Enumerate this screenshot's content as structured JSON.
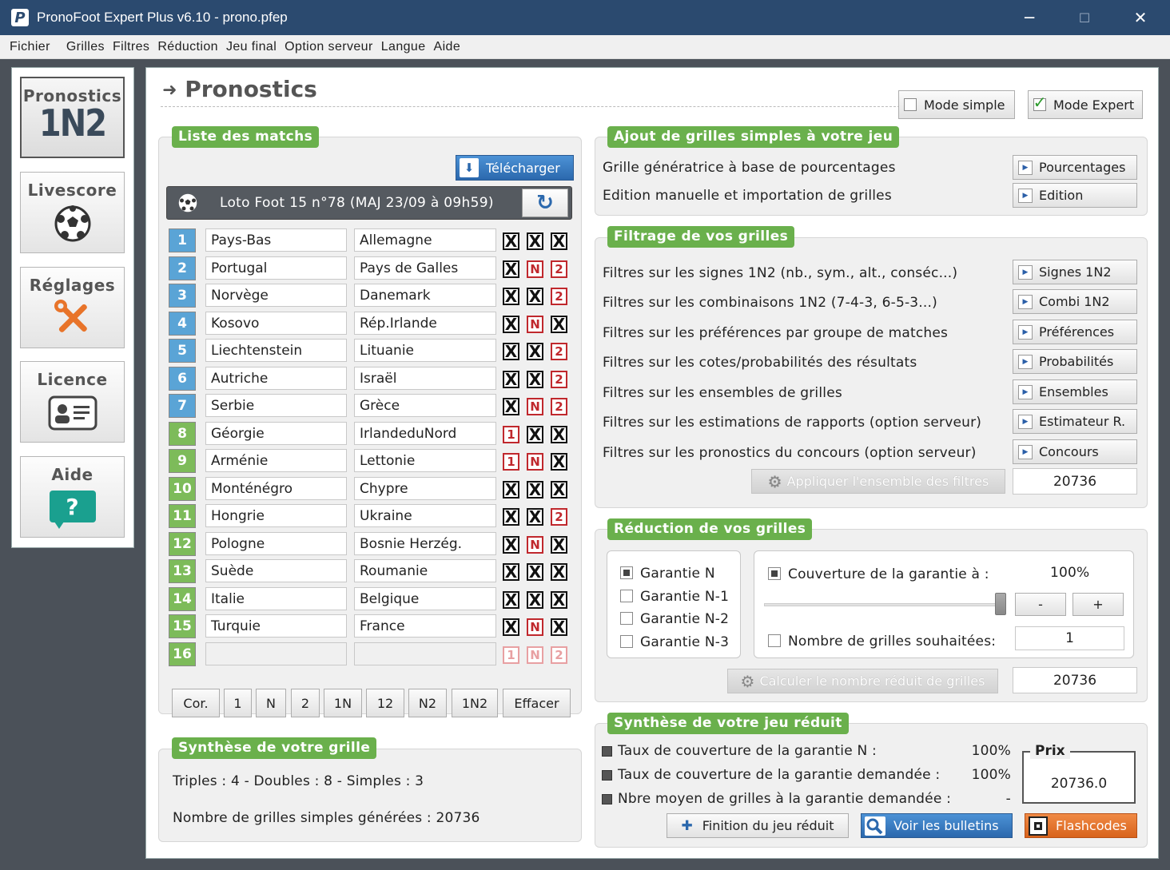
{
  "window": {
    "title": "PronoFoot Expert Plus v6.10 - prono.pfep",
    "app_icon": "P",
    "minimize": "─",
    "maximize": "☐",
    "close": "✕"
  },
  "menu": [
    "Fichier",
    "Grilles",
    "Filtres",
    "Réduction",
    "Jeu final",
    "Option serveur",
    "Langue",
    "Aide"
  ],
  "nav": [
    {
      "label": "Pronostics",
      "sub": "1N2",
      "icon": "1n2-icon"
    },
    {
      "label": "Livescore",
      "icon": "soccer-ball-icon"
    },
    {
      "label": "Réglages",
      "icon": "tools-icon"
    },
    {
      "label": "Licence",
      "icon": "id-card-icon"
    },
    {
      "label": "Aide",
      "icon": "help-bubble-icon",
      "glyph": "?"
    }
  ],
  "page": {
    "arrow": "➜",
    "title": "Pronostics",
    "mode_simple": "Mode simple",
    "mode_expert": "Mode Expert",
    "check": "✓"
  },
  "matches": {
    "section": "Liste des matchs",
    "download": "Télécharger",
    "download_icon": "⬇",
    "refresh": "↻",
    "header": "Loto Foot 15 n°78 (MAJ 23/09 à 09h59)",
    "rows": [
      {
        "n": "1",
        "home": "Pays-Bas",
        "away": "Allemagne",
        "s": [
          "X",
          "X",
          "X"
        ]
      },
      {
        "n": "2",
        "home": "Portugal",
        "away": "Pays de Galles",
        "s": [
          "X",
          "N",
          "2"
        ]
      },
      {
        "n": "3",
        "home": "Norvège",
        "away": "Danemark",
        "s": [
          "X",
          "X",
          "2"
        ]
      },
      {
        "n": "4",
        "home": "Kosovo",
        "away": "Rép.Irlande",
        "s": [
          "X",
          "N",
          "X"
        ]
      },
      {
        "n": "5",
        "home": "Liechtenstein",
        "away": "Lituanie",
        "s": [
          "X",
          "X",
          "2"
        ]
      },
      {
        "n": "6",
        "home": "Autriche",
        "away": "Israël",
        "s": [
          "X",
          "X",
          "2"
        ]
      },
      {
        "n": "7",
        "home": "Serbie",
        "away": "Grèce",
        "s": [
          "X",
          "N",
          "2"
        ]
      },
      {
        "n": "8",
        "home": "Géorgie",
        "away": "IrlandeduNord",
        "s": [
          "1",
          "X",
          "X"
        ]
      },
      {
        "n": "9",
        "home": "Arménie",
        "away": "Lettonie",
        "s": [
          "1",
          "N",
          "X"
        ]
      },
      {
        "n": "10",
        "home": "Monténégro",
        "away": "Chypre",
        "s": [
          "X",
          "X",
          "X"
        ]
      },
      {
        "n": "11",
        "home": "Hongrie",
        "away": "Ukraine",
        "s": [
          "X",
          "X",
          "2"
        ]
      },
      {
        "n": "12",
        "home": "Pologne",
        "away": "Bosnie Herzég.",
        "s": [
          "X",
          "N",
          "X"
        ]
      },
      {
        "n": "13",
        "home": "Suède",
        "away": "Roumanie",
        "s": [
          "X",
          "X",
          "X"
        ]
      },
      {
        "n": "14",
        "home": "Italie",
        "away": "Belgique",
        "s": [
          "X",
          "X",
          "X"
        ]
      },
      {
        "n": "15",
        "home": "Turquie",
        "away": "France",
        "s": [
          "X",
          "N",
          "X"
        ]
      },
      {
        "n": "16",
        "home": "",
        "away": "",
        "s": [
          "1",
          "N",
          "2"
        ]
      }
    ],
    "buttons": [
      "Cor.",
      "1",
      "N",
      "2",
      "1N",
      "12",
      "N2",
      "1N2",
      "Effacer"
    ]
  },
  "synth_grille": {
    "section": "Synthèse de votre grille",
    "line1": "Triples : 4 - Doubles : 8 - Simples : 3",
    "line2": "Nombre de grilles simples générées : 20736"
  },
  "ajout": {
    "section": "Ajout de grilles simples à votre jeu",
    "rows": [
      {
        "text": "Grille génératrice à base de pourcentages",
        "btn": "Pourcentages"
      },
      {
        "text": "Edition manuelle et importation de grilles",
        "btn": "Edition"
      }
    ]
  },
  "filtrage": {
    "section": "Filtrage de vos grilles",
    "rows": [
      {
        "text": "Filtres sur les signes 1N2 (nb., sym., alt., conséc...)",
        "btn": "Signes 1N2"
      },
      {
        "text": "Filtres sur les combinaisons 1N2 (7-4-3, 6-5-3...)",
        "btn": "Combi 1N2"
      },
      {
        "text": "Filtres sur les préférences par groupe de matches",
        "btn": "Préférences"
      },
      {
        "text": "Filtres sur les cotes/probabilités des résultats",
        "btn": "Probabilités"
      },
      {
        "text": "Filtres sur les ensembles de grilles",
        "btn": "Ensembles"
      },
      {
        "text": "Filtres sur les estimations de rapports (option serveur)",
        "btn": "Estimateur R."
      },
      {
        "text": "Filtres sur les pronostics du concours (option serveur)",
        "btn": "Concours"
      }
    ],
    "apply": "Appliquer l'ensemble des filtres",
    "count": "20736",
    "play": "▶",
    "gear": "⚙"
  },
  "reduction": {
    "section": "Réduction de vos grilles",
    "garanties": [
      "Garantie N",
      "Garantie N-1",
      "Garantie N-2",
      "Garantie N-3"
    ],
    "couverture_label": "Couverture de la garantie à :",
    "couverture_value": "100%",
    "minus": "-",
    "plus": "+",
    "nb_label": "Nombre de grilles souhaitées:",
    "nb_value": "1",
    "calc": "Calculer le nombre réduit de grilles",
    "count": "20736",
    "coverage_fraction": 1.0
  },
  "synth_jeu": {
    "section": "Synthèse de votre jeu réduit",
    "rows": [
      {
        "text": "Taux de couverture de la garantie N :",
        "value": "100%"
      },
      {
        "text": "Taux de couverture de la garantie demandée :",
        "value": "100%"
      },
      {
        "text": "Nbre moyen de grilles à la garantie demandée :",
        "value": "-"
      }
    ],
    "prix_label": "Prix",
    "prix_value": "20736.0",
    "finition": "Finition du jeu réduit",
    "voir": "Voir les bulletins",
    "flash": "Flashcodes",
    "plus": "✚"
  },
  "colors": {
    "green": "#6ab04c",
    "blue_num": "#5aa4d6",
    "green_num": "#7dbb5a",
    "orange": "#e8742a",
    "titlebar": "#2b4a6f"
  }
}
